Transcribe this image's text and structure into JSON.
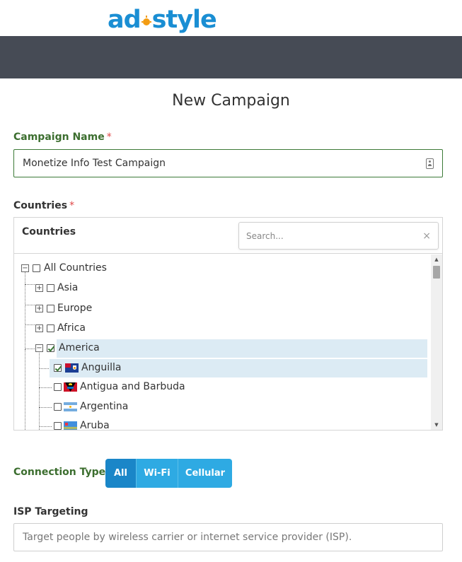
{
  "brand": {
    "logo_left": "ad",
    "logo_right": "style",
    "color": "#1a8ed3",
    "sun_color": "#f39c12"
  },
  "page": {
    "title": "New Campaign"
  },
  "campaign_name": {
    "label": "Campaign Name",
    "required_mark": "*",
    "value": "Monetize Info Test Campaign",
    "icon": "contact-card-icon"
  },
  "countries": {
    "label": "Countries",
    "required_mark": "*",
    "panel_title": "Countries",
    "search_placeholder": "Search...",
    "clear_glyph": "×",
    "tree": [
      {
        "label": "All Countries",
        "level": 0,
        "expand": "−",
        "checked": false,
        "selected": false
      },
      {
        "label": "Asia",
        "level": 1,
        "expand": "+",
        "checked": false,
        "selected": false
      },
      {
        "label": "Europe",
        "level": 1,
        "expand": "+",
        "checked": false,
        "selected": false
      },
      {
        "label": "Africa",
        "level": 1,
        "expand": "+",
        "checked": false,
        "selected": false
      },
      {
        "label": "America",
        "level": 1,
        "expand": "−",
        "checked": true,
        "selected": true
      },
      {
        "label": "Anguilla",
        "level": 2,
        "checked": true,
        "selected": true,
        "flag": "anguilla-flag"
      },
      {
        "label": "Antigua and Barbuda",
        "level": 2,
        "checked": false,
        "selected": false,
        "flag": "antigua-flag"
      },
      {
        "label": "Argentina",
        "level": 2,
        "checked": false,
        "selected": false,
        "flag": "argentina-flag"
      },
      {
        "label": "Aruba",
        "level": 2,
        "checked": false,
        "selected": false,
        "flag": "aruba-flag"
      }
    ]
  },
  "connection_type": {
    "label": "Connection Type",
    "options": [
      "All",
      "Wi-Fi",
      "Cellular"
    ],
    "selected": "All"
  },
  "isp_targeting": {
    "label": "ISP Targeting",
    "placeholder": "Target people by wireless carrier or internet service provider (ISP)."
  },
  "colors": {
    "navbar": "#464b55",
    "label_green": "#3c6e2f",
    "required": "#e04848",
    "accent": "#2eaae3",
    "accent_active": "#1a86c8",
    "selection": "#dcebf4"
  }
}
